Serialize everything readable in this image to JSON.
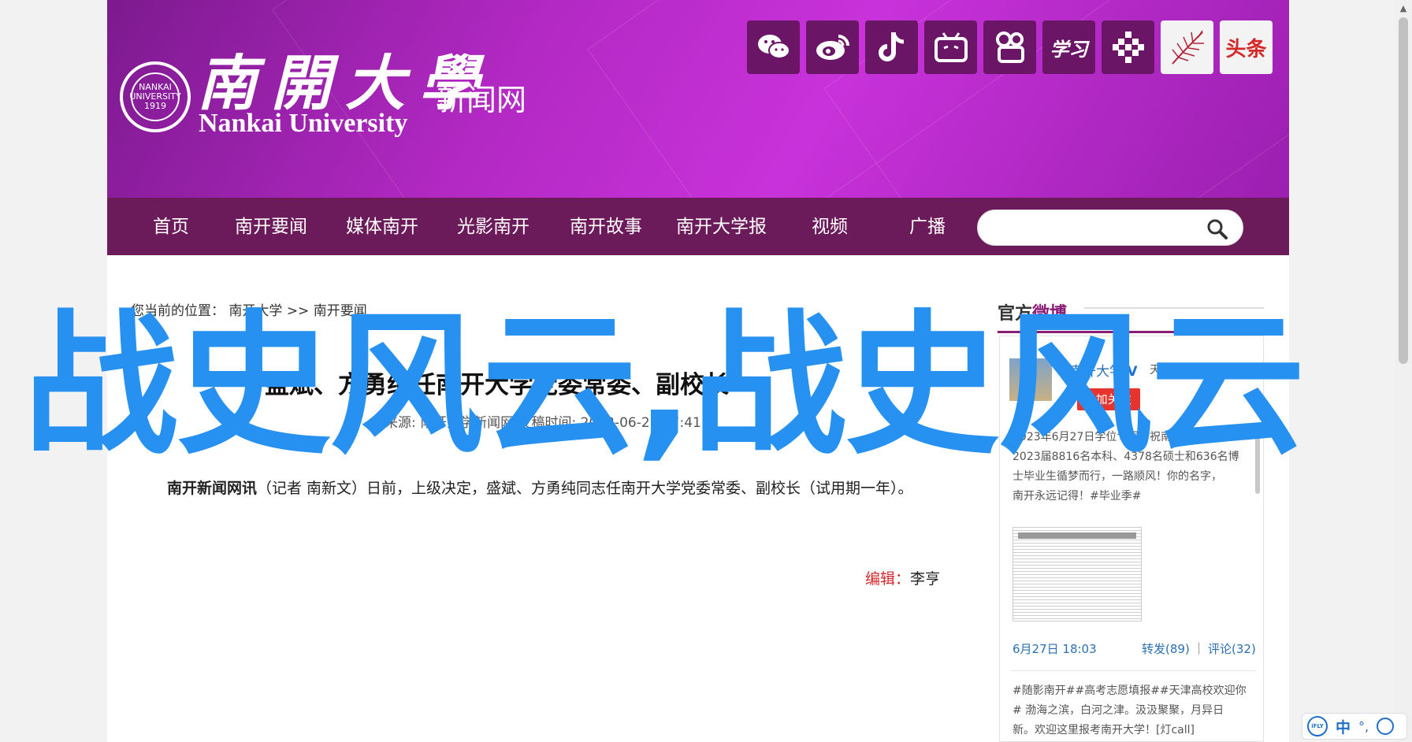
{
  "header": {
    "logo_cn": "南開大學",
    "logo_en": "Nankai University",
    "logo_seal_text": "NANKAI UNIVERSITY 1919",
    "site_name": "新闻网",
    "social_icons": [
      "wechat-icon",
      "weibo-icon",
      "tiktok-icon",
      "bilibili-icon",
      "kuaishou-icon",
      "xuexi-icon",
      "app-grid-icon",
      "feather-icon",
      "toutiao-icon"
    ],
    "toutiao_label": "头条",
    "xuexi_label": "学习"
  },
  "nav": {
    "items": [
      "首页",
      "南开要闻",
      "媒体南开",
      "光影南开",
      "南开故事",
      "南开大学报",
      "视频",
      "广播"
    ],
    "search_placeholder": ""
  },
  "breadcrumb": {
    "prefix": "您当前的位置：",
    "path": [
      "南开大学",
      ">>",
      "南开要闻"
    ]
  },
  "article": {
    "title": "盛斌、方勇纯任南开大学党委常委、副校长",
    "meta": "来源: 南开大学新闻网    发稿时间: 2023-06-27 17:41",
    "source_name": "南开新闻网讯",
    "body": "（记者 南新文）日前，上级决定，盛斌、方勇纯同志任南开大学党委常委、副校长（试用期一年）。",
    "editor_label": "编辑：",
    "editor_name": "李亨"
  },
  "sidebar": {
    "heading_prefix": "官方",
    "heading_accent": "微博",
    "account_name": "南开大学",
    "verified_mark": "V",
    "location": "天津",
    "follow_label": "+加关注",
    "post1_lines": [
      "2023年6月27日学位专报 | 祝南开大学",
      "2023届8816名本科、4378名硕士和636名博",
      "士毕业生循梦而行，一路顺风！你的名字，",
      "南开永远记得！#毕业季#"
    ],
    "post1_image_caption": "南开大学2023届毕业生名单",
    "post1_time": "6月27日 18:03",
    "post1_repost": "转发(89)",
    "post1_sep": "|",
    "post1_comment": "评论(32)",
    "post2_lines": [
      "#随影南开##高考志愿填报##天津高校欢迎你",
      "# 渤海之滨，白河之津。汲汲聚聚，月异日",
      "新。欢迎这里报考南开大学！[灯call]"
    ]
  },
  "overlay_text": "战史风云,战史风云",
  "ime": {
    "logo": "iFLY",
    "lang": "中",
    "dot": "°,",
    "icons": [
      "ifly-logo-icon",
      "punctuation-icon",
      "microphone-icon"
    ]
  },
  "colors": {
    "banner": "#b329c4",
    "nav": "#6b1a5a",
    "accent": "#8a1d75",
    "overlay": "#2691f0",
    "link_blue": "#2a6fb5",
    "editor_red": "#d4282b"
  }
}
